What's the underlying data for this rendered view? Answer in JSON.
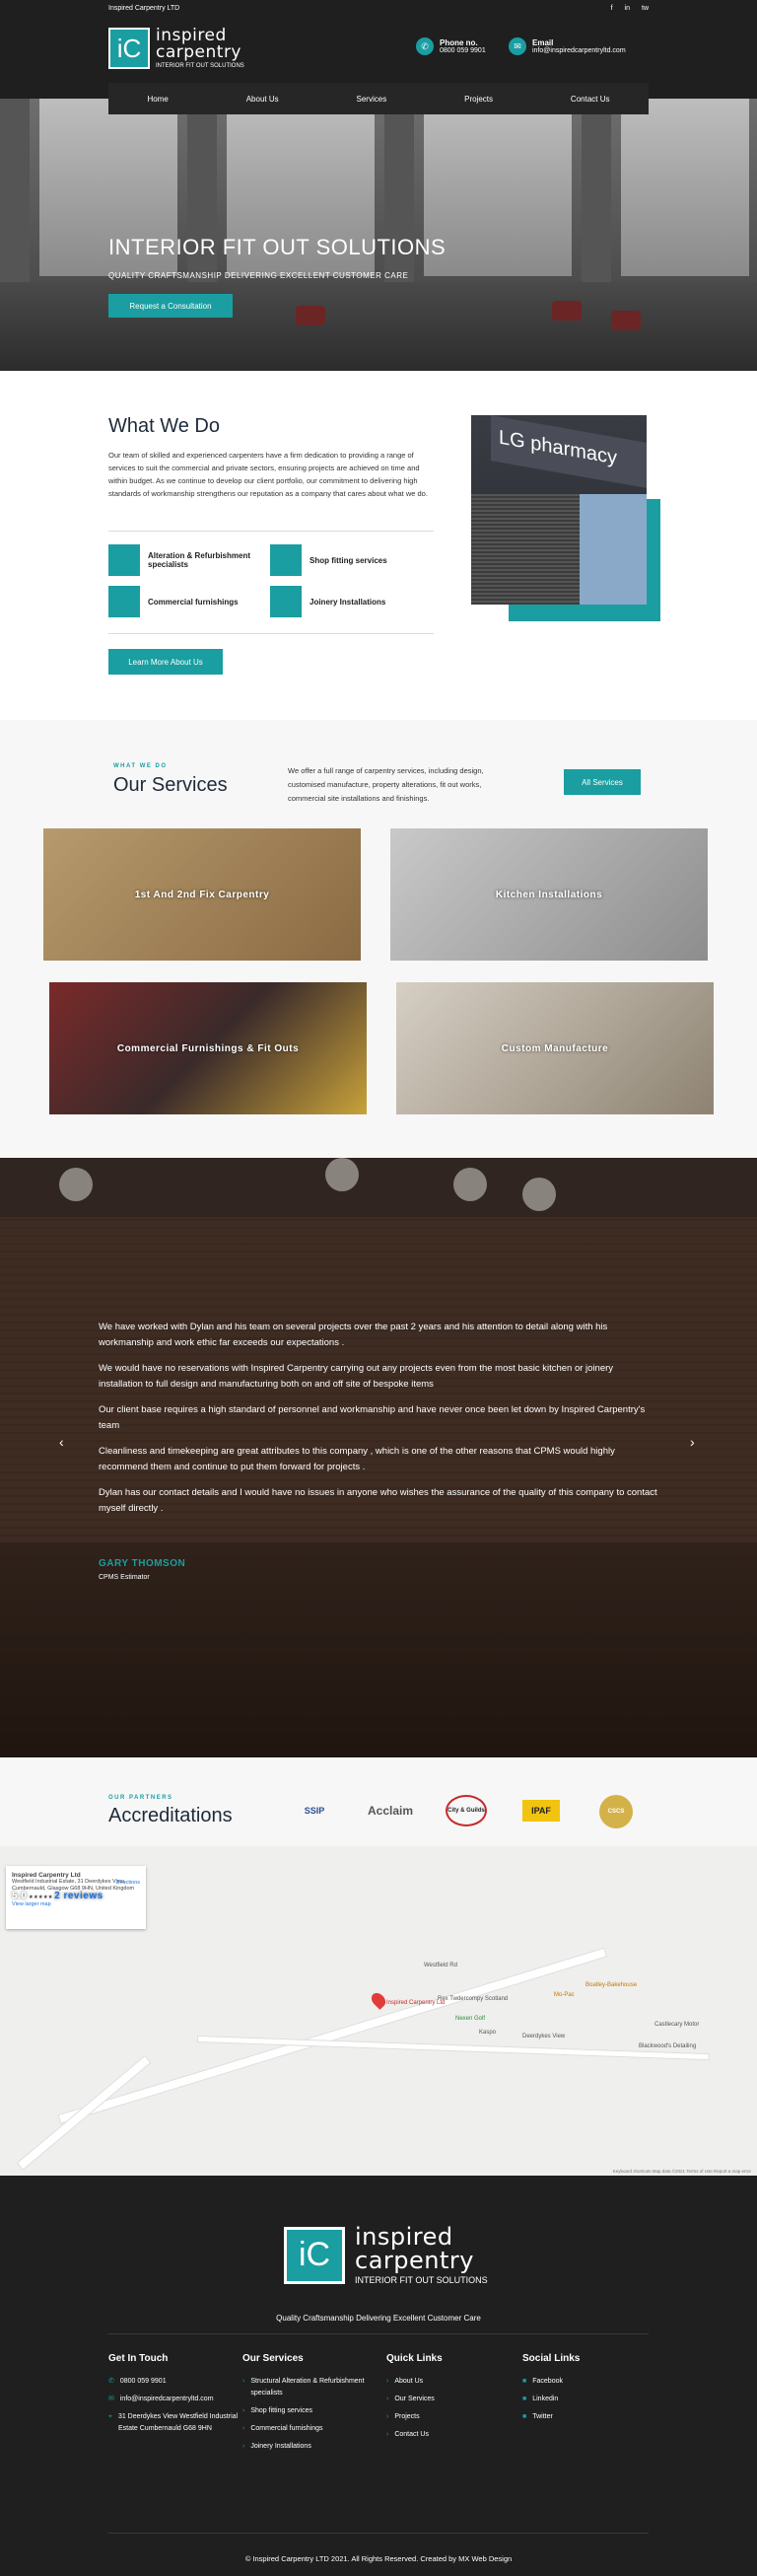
{
  "topbar": {
    "company": "Inspired Carpentry LTD",
    "social": [
      "f",
      "in",
      "tw"
    ]
  },
  "logo": {
    "mark": "iC",
    "line1": "inspired",
    "line2": "carpentry",
    "line3": "INTERIOR FIT OUT SOLUTIONS"
  },
  "header": {
    "phone_label": "Phone no.",
    "phone_value": "0800 059 9901",
    "email_label": "Email",
    "email_value": "info@inspiredcarpentryltd.com"
  },
  "nav": [
    "Home",
    "About Us",
    "Services",
    "Projects",
    "Contact Us"
  ],
  "hero": {
    "title": "INTERIOR FIT OUT SOLUTIONS",
    "subtitle": "QUALITY CRAFTSMANSHIP DELIVERING EXCELLENT CUSTOMER CARE",
    "cta": "Request a Consultation"
  },
  "about": {
    "title": "What We Do",
    "text": "Our team of skilled and experienced carpenters have a firm dedication to providing a range of services to suit the commercial and private sectors, ensuring projects are achieved on time and within budget. As we continue to develop our client portfolio, our commitment to delivering high standards of workmanship strengthens our reputation as a company that cares about what we do.",
    "features": [
      "Alteration & Refurbishment specialists",
      "Shop fitting services",
      "Commercial furnishings",
      "Joinery Installations"
    ],
    "cta": "Learn More About Us",
    "image_sign": "LG pharmacy"
  },
  "services": {
    "eyebrow": "WHAT WE DO",
    "title": "Our Services",
    "text": "We offer a full range of carpentry services, including design, customised manufacture, property alterations, fit out works, commercial site installations and finishings.",
    "cta": "All Services",
    "cards": [
      "1st And 2nd Fix Carpentry",
      "Kitchen Installations",
      "Commercial Furnishings & Fit Outs",
      "Custom Manufacture"
    ]
  },
  "testimonial": {
    "paragraphs": [
      "We have worked with Dylan and his team on several projects over the past 2 years and his attention to detail along with his workmanship and work ethic far exceeds our expectations .",
      "We would have no reservations with Inspired Carpentry carrying out any projects even from the most basic kitchen or joinery installation to full design and manufacturing both on and off site of bespoke items",
      "Our client base requires a high standard of personnel and workmanship and have never once been let down by Inspired Carpentry's team",
      "Cleanliness and timekeeping are great attributes to this company , which is one of the other reasons that CPMS would highly recommend them and continue to put them forward for projects .",
      "Dylan has our contact details and I would have no issues in anyone who wishes the assurance of the quality of this company to contact myself directly ."
    ],
    "author": "GARY THOMSON",
    "role": "CPMS Estimator",
    "prev": "‹",
    "next": "›"
  },
  "partners": {
    "eyebrow": "OUR PARTNERS",
    "title": "Accreditations",
    "logos": [
      "SSIP",
      "Acclaim",
      "City & Guilds",
      "IPAF",
      "CSCS"
    ]
  },
  "map": {
    "place_name": "Inspired Carpentry Ltd",
    "address": "Westfield Industrial Estate, 31 Deerdykes View, Cumbernauld, Glasgow G68 9HN, United Kingdom",
    "rating": "5.0",
    "reviews": "2 reviews",
    "view_larger": "View larger map",
    "directions": "Directions",
    "road1": "Westfield Rd",
    "road2": "Deerdykes View",
    "pin_label": "Inspired Carpentry Ltd",
    "places": [
      "Nexen Golf",
      "Rex Twdercompy Scotland",
      "Castlecary Motor",
      "Blackwood's Detailing",
      "Kaspo",
      "Mo-Pac",
      "Boatley-Bakehouse"
    ],
    "footnote": "Keyboard shortcuts  Map data ©2021  Terms of Use  Report a map error"
  },
  "footer": {
    "tagline": "Quality Craftsmanship Delivering Excellent Customer Care",
    "touch_title": "Get In Touch",
    "touch": [
      "0800 059 9901",
      "info@inspiredcarpentryltd.com",
      "31 Deerdykes View Westfield Industrial Estate Cumbernauld G68 9HN"
    ],
    "services_title": "Our Services",
    "services": [
      "Structural Alteration & Refurbishment specialists",
      "Shop fitting services",
      "Commercial furnishings",
      "Joinery Installations"
    ],
    "links_title": "Quick Links",
    "links": [
      "About Us",
      "Our Services",
      "Projects",
      "Contact Us"
    ],
    "social_title": "Social Links",
    "social": [
      "Facebook",
      "Linkedin",
      "Twitter"
    ],
    "copyright": "© Inspired Carpentry LTD 2021. All Rights Reserved. Created by MX Web Design"
  },
  "colors": {
    "accent": "#1a9ea1",
    "dark": "#1f1f1f"
  }
}
